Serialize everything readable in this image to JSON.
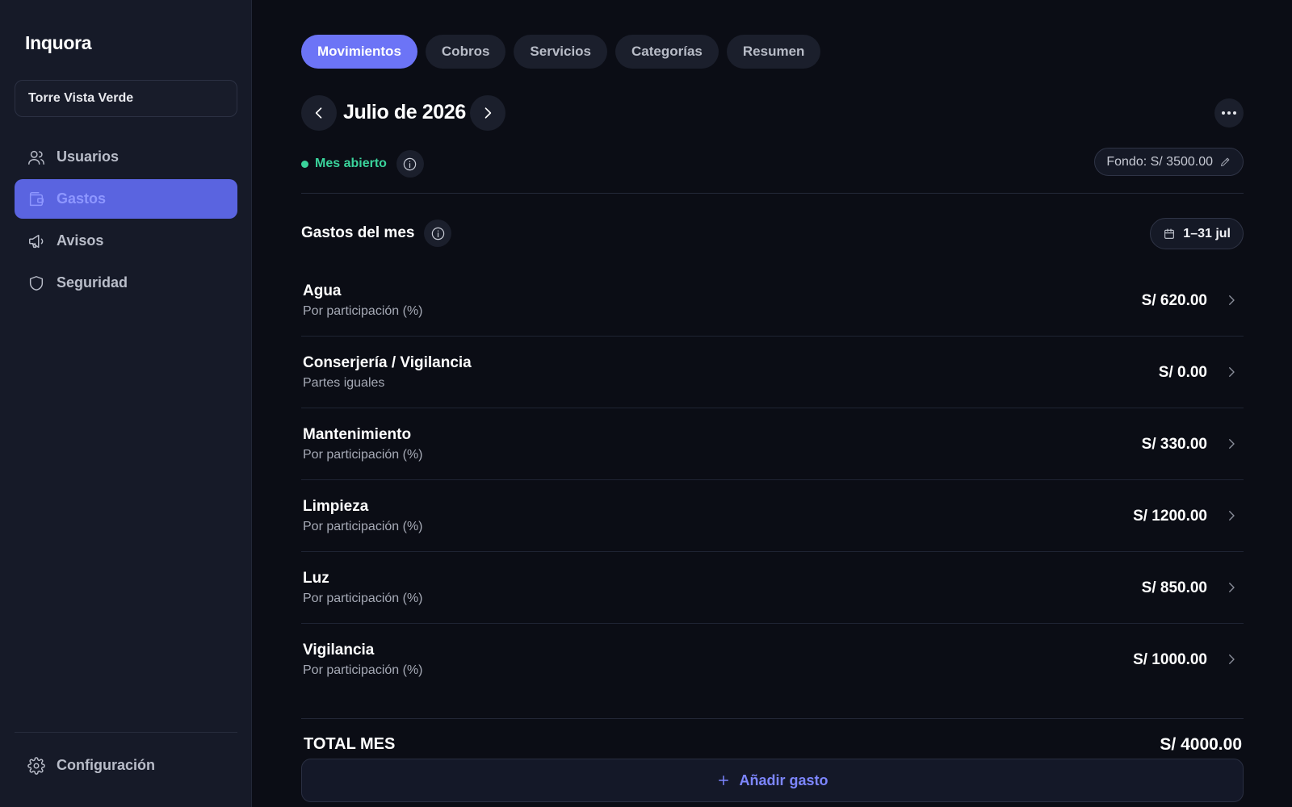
{
  "app": {
    "brand": "Inquora"
  },
  "sidebar": {
    "building": "Torre Vista Verde",
    "items": [
      {
        "label": "Usuarios",
        "icon": "users-icon",
        "active": false
      },
      {
        "label": "Gastos",
        "icon": "wallet-icon",
        "active": true
      },
      {
        "label": "Avisos",
        "icon": "megaphone-icon",
        "active": false
      },
      {
        "label": "Seguridad",
        "icon": "shield-icon",
        "active": false
      }
    ],
    "settings": {
      "label": "Configuración",
      "icon": "gear-icon"
    }
  },
  "tabs": [
    {
      "label": "Movimientos",
      "active": true
    },
    {
      "label": "Cobros",
      "active": false
    },
    {
      "label": "Servicios",
      "active": false
    },
    {
      "label": "Categorías",
      "active": false
    },
    {
      "label": "Resumen",
      "active": false
    }
  ],
  "period": {
    "title": "Julio de 2026",
    "status": "Mes abierto",
    "status_color": "#3ad39b",
    "fund": "Fondo: S/ 3500.00"
  },
  "expenses": {
    "title": "Gastos del mes",
    "range": "1–31 jul",
    "rows": [
      {
        "name": "Agua",
        "method": "Por participación (%)",
        "amount": "S/ 620.00"
      },
      {
        "name": "Conserjería / Vigilancia",
        "method": "Partes iguales",
        "amount": "S/ 0.00"
      },
      {
        "name": "Mantenimiento",
        "method": "Por participación (%)",
        "amount": "S/ 330.00"
      },
      {
        "name": "Limpieza",
        "method": "Por participación (%)",
        "amount": "S/ 1200.00"
      },
      {
        "name": "Luz",
        "method": "Por participación (%)",
        "amount": "S/ 850.00"
      },
      {
        "name": "Vigilancia",
        "method": "Por participación (%)",
        "amount": "S/ 1000.00"
      }
    ],
    "total_label": "TOTAL MES",
    "total_value": "S/ 4000.00",
    "add_label": "Añadir gasto"
  },
  "colors": {
    "accent": "#6c74f6",
    "active_nav": "#5a64e0",
    "background": "#0b0d15",
    "sidebar": "#161a28"
  }
}
